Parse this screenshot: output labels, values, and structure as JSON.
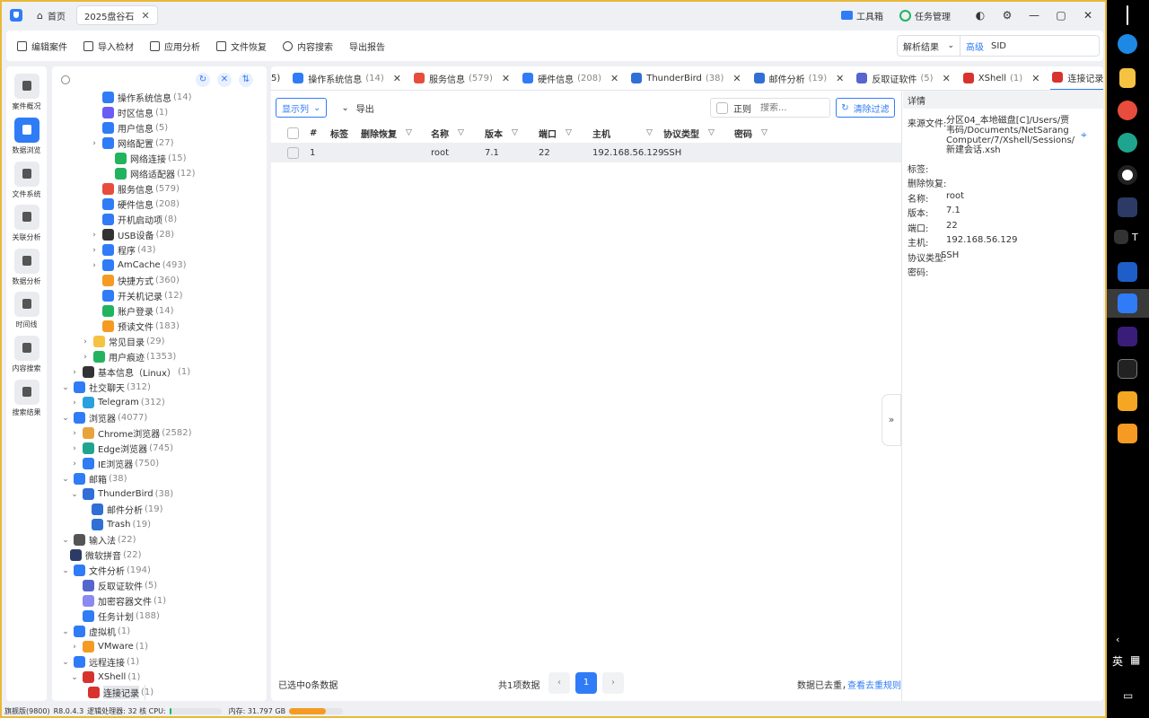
{
  "titlebar": {
    "home_label": "首页",
    "case_tab": "2025盘谷石",
    "toolbox": "工具箱",
    "task_mgr": "任务管理",
    "min": "—",
    "max": "▢",
    "close": "✕"
  },
  "toolbar": {
    "items": [
      "编辑案件",
      "导入检材",
      "应用分析",
      "文件恢复",
      "内容搜索",
      "导出报告"
    ],
    "search_type": "解析结果",
    "advanced": "高级",
    "search_value": "SID"
  },
  "sidebar": {
    "items": [
      "案件概况",
      "数据浏览",
      "文件系统",
      "关联分析",
      "数据分析",
      "时间线",
      "内容搜索",
      "搜索结果"
    ]
  },
  "tree": [
    {
      "label": "操作系统信息",
      "count": "(14)",
      "color": "#2f7cf6"
    },
    {
      "label": "时区信息",
      "count": "(1)",
      "color": "#6b5cf6"
    },
    {
      "label": "用户信息",
      "count": "(5)",
      "color": "#2f7cf6"
    },
    {
      "label": "网络配置",
      "count": "(27)",
      "color": "#2f7cf6"
    },
    {
      "label": "网络连接",
      "count": "(15)",
      "color": "#22b35e"
    },
    {
      "label": "网络适配器",
      "count": "(12)",
      "color": "#22b35e"
    },
    {
      "label": "服务信息",
      "count": "(579)",
      "color": "#e84c3d"
    },
    {
      "label": "硬件信息",
      "count": "(208)",
      "color": "#2f7cf6"
    },
    {
      "label": "开机启动项",
      "count": "(8)",
      "color": "#2f7cf6"
    },
    {
      "label": "USB设备",
      "count": "(28)",
      "color": "#333333"
    },
    {
      "label": "程序",
      "count": "(43)",
      "color": "#2f7cf6"
    },
    {
      "label": "AmCache",
      "count": "(493)",
      "color": "#2f7cf6"
    },
    {
      "label": "快捷方式",
      "count": "(360)",
      "color": "#f59a23"
    },
    {
      "label": "开关机记录",
      "count": "(12)",
      "color": "#2f7cf6"
    },
    {
      "label": "账户登录",
      "count": "(14)",
      "color": "#22b35e"
    },
    {
      "label": "预读文件",
      "count": "(183)",
      "color": "#f59a23"
    },
    {
      "label": "常见目录",
      "count": "(29)",
      "color": "#f5c242"
    },
    {
      "label": "用户痕迹",
      "count": "(1353)",
      "color": "#22b35e"
    },
    {
      "label": "基本信息（Linux）",
      "count": "(1)",
      "color": "#333333"
    },
    {
      "label": "社交聊天",
      "count": "(312)",
      "color": "#2f7cf6"
    },
    {
      "label": "Telegram",
      "count": "(312)",
      "color": "#2aa1de"
    },
    {
      "label": "浏览器",
      "count": "(4077)",
      "color": "#2f7cf6"
    },
    {
      "label": "Chrome浏览器",
      "count": "(2582)",
      "color": "#e8a33d"
    },
    {
      "label": "Edge浏览器",
      "count": "(745)",
      "color": "#1fa58f"
    },
    {
      "label": "IE浏览器",
      "count": "(750)",
      "color": "#2f7cf6"
    },
    {
      "label": "邮箱",
      "count": "(38)",
      "color": "#2f7cf6"
    },
    {
      "label": "ThunderBird",
      "count": "(38)",
      "color": "#2f6fd6"
    },
    {
      "label": "邮件分析",
      "count": "(19)",
      "color": "#2f6fd6"
    },
    {
      "label": "Trash",
      "count": "(19)",
      "color": "#2f6fd6"
    },
    {
      "label": "输入法",
      "count": "(22)",
      "color": "#555555"
    },
    {
      "label": "微软拼音",
      "count": "(22)",
      "color": "#2d3a66"
    },
    {
      "label": "文件分析",
      "count": "(194)",
      "color": "#2f7cf6"
    },
    {
      "label": "反取证软件",
      "count": "(5)",
      "color": "#5566cc"
    },
    {
      "label": "加密容器文件",
      "count": "(1)",
      "color": "#8a8af0"
    },
    {
      "label": "任务计划",
      "count": "(188)",
      "color": "#2f7cf6"
    },
    {
      "label": "虚拟机",
      "count": "(1)",
      "color": "#2f7cf6"
    },
    {
      "label": "VMware",
      "count": "(1)",
      "color": "#f59a23"
    },
    {
      "label": "远程连接",
      "count": "(1)",
      "color": "#2f7cf6"
    },
    {
      "label": "XShell",
      "count": "(1)",
      "color": "#d8322e"
    },
    {
      "label": "连接记录",
      "count": "(1)",
      "color": "#d8322e"
    }
  ],
  "tabs": [
    {
      "label": "操作系统信息",
      "count": "(14)",
      "color": "#2f7cf6"
    },
    {
      "label": "服务信息",
      "count": "(579)",
      "color": "#e84c3d"
    },
    {
      "label": "硬件信息",
      "count": "(208)",
      "color": "#2f7cf6"
    },
    {
      "label": "ThunderBird",
      "count": "(38)",
      "color": "#2f6fd6"
    },
    {
      "label": "邮件分析",
      "count": "(19)",
      "color": "#2f6fd6"
    },
    {
      "label": "反取证软件",
      "count": "(5)",
      "color": "#5566cc"
    },
    {
      "label": "XShell",
      "count": "(1)",
      "color": "#d8322e"
    },
    {
      "label": "连接记录",
      "count": "(1)",
      "color": "#d8322e"
    }
  ],
  "tab_partial": "5)",
  "grid": {
    "show_cols": "显示列",
    "export": "导出",
    "regex": "正则",
    "search_placeholder": "搜索...",
    "clear_filter": "清除过滤",
    "headers": {
      "num": "#",
      "tag": "标签",
      "deleted": "删除恢复",
      "name": "名称",
      "version": "版本",
      "port": "端口",
      "host": "主机",
      "protocol": "协议类型",
      "password": "密码"
    },
    "rows": [
      {
        "num": "1",
        "tag": "",
        "deleted": "",
        "name": "root",
        "version": "7.1",
        "port": "22",
        "host": "192.168.56.129",
        "protocol": "SSH",
        "password": ""
      }
    ],
    "selected_text": "已选中0条数据",
    "total_text": "共1项数据",
    "page": "1",
    "dedup_text": "数据已去重，",
    "dedup_link": "查看去重规则"
  },
  "detail": {
    "title": "详情",
    "source_label": "来源文件:",
    "source_value": "分区04_本地磁盘[C]/Users/贾韦码/Documents/NetSarang Computer/7/Xshell/Sessions/新建会话.xsh",
    "tag_label": "标签:",
    "deleted_label": "删除恢复:",
    "name_label": "名称:",
    "name_value": "root",
    "version_label": "版本:",
    "version_value": "7.1",
    "port_label": "端口:",
    "port_value": "22",
    "host_label": "主机:",
    "host_value": "192.168.56.129",
    "protocol_label": "协议类型:",
    "protocol_value": "SSH",
    "password_label": "密码:"
  },
  "status": {
    "edition": "旗舰版(9800)",
    "version": "R8.0.4.3",
    "cpu_text": "逻辑处理器: 32 核  CPU:",
    "cpu_fraction": 0.04,
    "mem_text": "内存: 31.797 GB",
    "mem_fraction": 0.68
  },
  "taskbar": {
    "ime": "英",
    "t_label": "T"
  }
}
